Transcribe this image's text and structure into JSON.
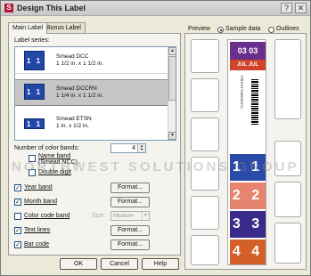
{
  "window": {
    "title": "Design This Label",
    "app_icon": "S"
  },
  "tabs": [
    {
      "label": "Main Label"
    },
    {
      "label": "Bonus Label"
    }
  ],
  "main": {
    "label_series_heading": "Label series:",
    "series": [
      {
        "name": "Smead DCC",
        "size": "1 1/2 in. x 1 1/2 in.",
        "swatch": "1 1"
      },
      {
        "name": "Smead DCCRN",
        "size": "1 1/4 in. x 1 1/2 in.",
        "swatch": "1 1"
      },
      {
        "name": "Smead ETSN",
        "size": "1 in. x 1/2 in.",
        "swatch": "1 1"
      }
    ],
    "number_of_color_bands": {
      "label": "Number of color bands:",
      "value": "4"
    },
    "name_band": {
      "label": "Name band",
      "sub_label": "(Smead NCC)"
    },
    "double_digit": {
      "label": "Double digit"
    },
    "year_band": {
      "label": "Year band"
    },
    "month_band": {
      "label": "Month band"
    },
    "color_code_band": {
      "label": "Color code band"
    },
    "size_dropdown": {
      "label": "Size:",
      "value": "Medium"
    },
    "text_lines": {
      "label": "Text lines"
    },
    "bar_code": {
      "label": "Bar code"
    },
    "format_label": "Format..."
  },
  "footer": {
    "ok": "OK",
    "cancel": "Cancel",
    "help": "Help"
  },
  "preview": {
    "heading": "Preview",
    "sample_data": "Sample data",
    "outlines": "Outlines",
    "year_text": "03 03",
    "month_text": "JUL JUL",
    "text_lines_content": "FIRST/TTNE/MOTH...",
    "bands": [
      "1 1",
      "2 2",
      "3 3",
      "4 4"
    ],
    "watermark": "NORTHWEST SOLUTIONS GROUP",
    "colors": {
      "year": "#6a2e8c",
      "month": "#d1432b",
      "band1": "#2a4aa8",
      "band2": "#e7846f",
      "band3": "#3a2a8a",
      "band4": "#d35f29"
    }
  }
}
